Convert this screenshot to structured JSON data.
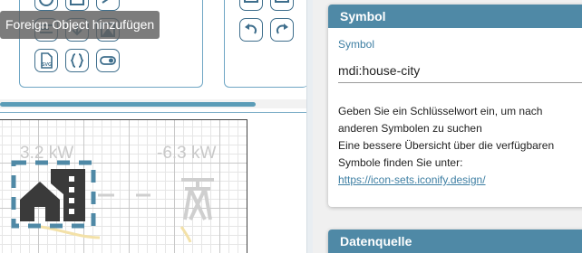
{
  "tooltip": {
    "text": "Foreign Object hinzufügen"
  },
  "toolbar": {
    "left_tools": [
      "circle-tool-icon",
      "rect-tool-icon",
      "text-align-icon",
      "arrow-down-icon",
      "image-tool-icon",
      "svg-file-icon",
      "curly-braces-icon",
      "toggle-icon"
    ],
    "right_tools": [
      "layer-front-icon",
      "layer-back-icon",
      "undo-icon",
      "redo-icon"
    ],
    "svg_label": "SVG"
  },
  "canvas": {
    "value_left": "3.2 kW",
    "value_right": "-6.3 kW"
  },
  "properties": {
    "symbol_section": {
      "title": "Symbol",
      "field_label": "Symbol",
      "field_value": "mdi:house-city",
      "help_line1": "Geben Sie ein Schlüsselwort ein, um nach",
      "help_line2": "anderen Symbolen zu suchen",
      "help_line3": "Eine bessere Übersicht über die verfügbaren",
      "help_line4": "Symbole finden Sie unter:",
      "help_link": "https://icon-sets.iconify.design/"
    },
    "source_section": {
      "title": "Datenquelle"
    }
  },
  "colors": {
    "accent": "#4f89a6",
    "link": "#3e7fa3",
    "selection_dash": "#4f89a6"
  }
}
